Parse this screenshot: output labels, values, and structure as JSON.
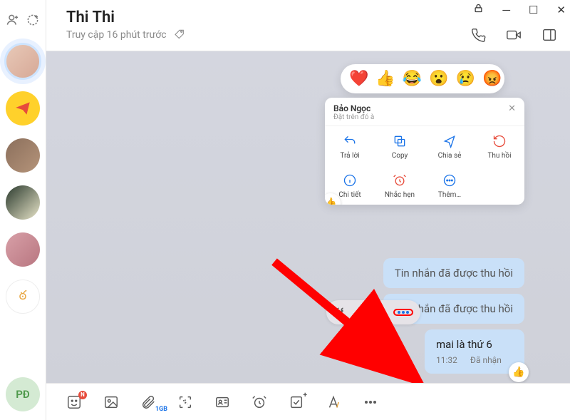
{
  "contact": {
    "name": "Thi Thi",
    "status": "Truy cập 16 phút trước"
  },
  "sidebar": {
    "bottom_initials": "PĐ"
  },
  "context_menu": {
    "quoted_name": "Bảo Ngọc",
    "quoted_sub": "Đặt trên đó à",
    "items": [
      {
        "label": "Trả lời"
      },
      {
        "label": "Copy"
      },
      {
        "label": "Chia sẻ"
      },
      {
        "label": "Thu hồi"
      },
      {
        "label": "Chi tiết"
      },
      {
        "label": "Nhắc hẹn"
      },
      {
        "label": "Thêm…"
      }
    ]
  },
  "messages": {
    "recalled1": "Tin nhắn đã được thu hồi",
    "recalled2": "Tin nhắn đã được thu hồi",
    "last_text": "mai là thứ 6",
    "last_time": "11:32",
    "last_status": "Đã nhận"
  },
  "toolbar": {
    "file_size": "1GB"
  }
}
